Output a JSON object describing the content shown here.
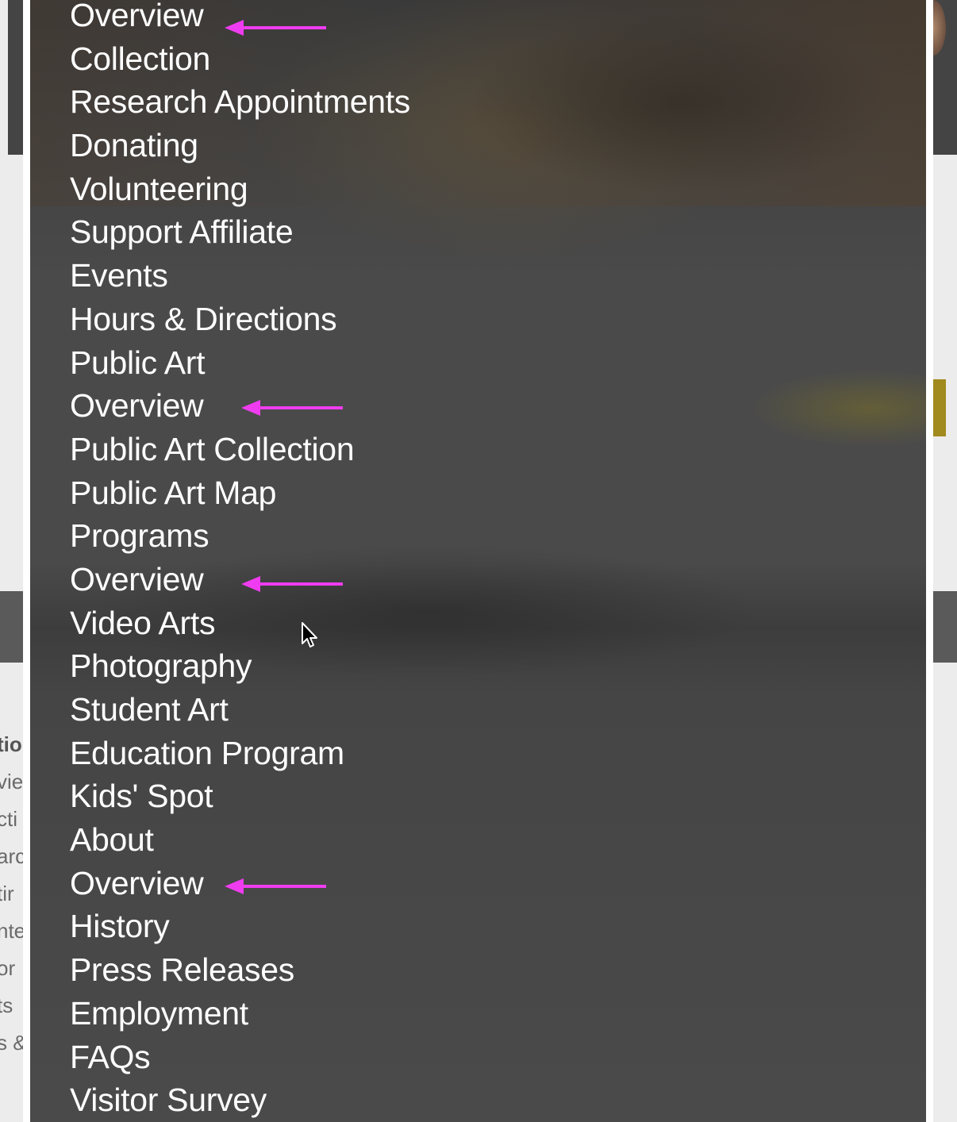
{
  "menu": {
    "items": [
      "Overview",
      "Collection",
      "Research Appointments",
      "Donating",
      "Volunteering",
      "Support Affiliate",
      "Events",
      "Hours & Directions",
      "Public Art",
      "Overview",
      "Public Art Collection",
      "Public Art Map",
      "Programs",
      "Overview",
      "Video Arts",
      "Photography",
      "Student Art",
      "Education Program",
      "Kids' Spot",
      "About",
      "Overview",
      "History",
      "Press Releases",
      "Employment",
      "FAQs",
      "Visitor Survey"
    ]
  },
  "annotations": {
    "arrow_color": "#f03cf0",
    "arrows_point_to": [
      "Overview",
      "Overview",
      "Overview",
      "Overview"
    ]
  },
  "background": {
    "left_partial_text": [
      "tio",
      "vie",
      "cti",
      "arc",
      "tir",
      "nte",
      "or",
      "ts",
      "s &"
    ]
  },
  "colors": {
    "menu_text": "#ffffff",
    "panel_background": "#4a4a4a",
    "gold_accent": "#a18a1e"
  }
}
